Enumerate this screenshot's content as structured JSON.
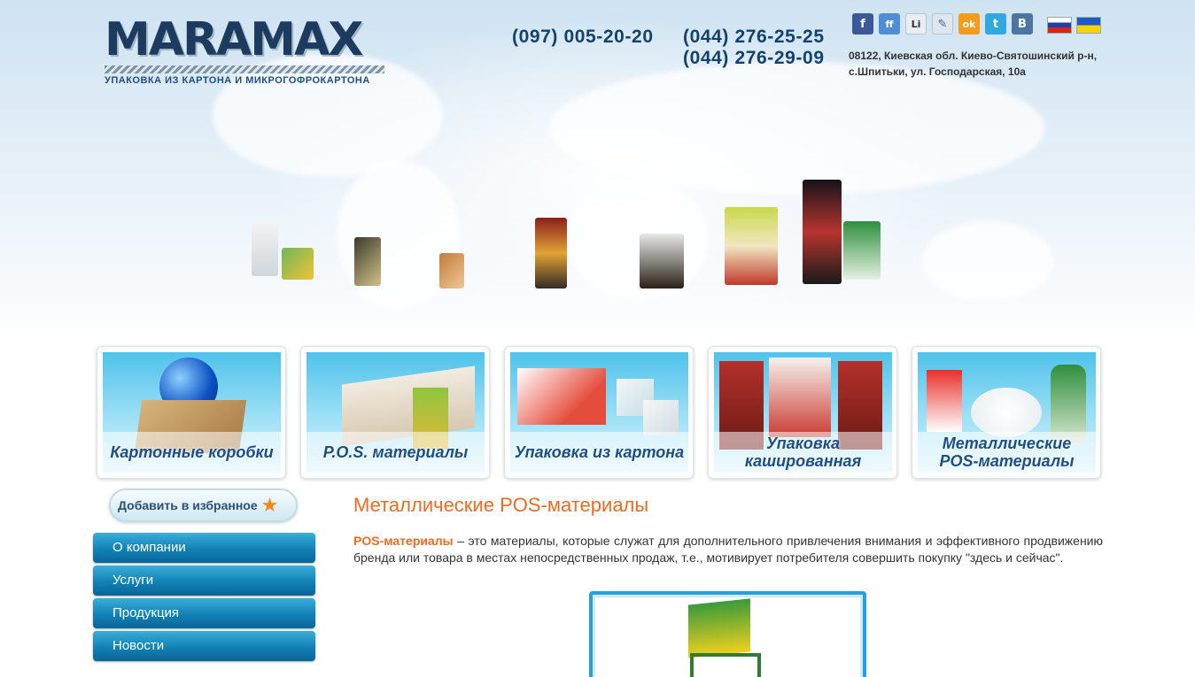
{
  "header": {
    "logo_text": "MARAMAX",
    "logo_subtitle": "УПАКОВКА ИЗ КАРТОНА И МИКРОГОФРОКАРТОНА",
    "phones": [
      "(097) 005-20-20",
      "(044) 276-25-25",
      "(044) 276-29-09"
    ],
    "address_line1": "08122, Киевская обл. Киево-Святошинский р-н,",
    "address_line2": "с.Шпитьки, ул. Господарская, 10а",
    "socials": [
      {
        "name": "facebook",
        "glyph": "f",
        "color": "#3b5998"
      },
      {
        "name": "friendfeed",
        "glyph": "ff",
        "color": "#4f8ed3"
      },
      {
        "name": "linkedin",
        "glyph": "Li",
        "color": "#e9eef2"
      },
      {
        "name": "livejournal",
        "glyph": "✎",
        "color": "#dfe6ee"
      },
      {
        "name": "odnoklassniki",
        "glyph": "ok",
        "color": "#f59a1b"
      },
      {
        "name": "twitter",
        "glyph": "t",
        "color": "#33a8e0"
      },
      {
        "name": "vkontakte",
        "glyph": "B",
        "color": "#4c75a3"
      }
    ],
    "languages": [
      "ru",
      "ua"
    ]
  },
  "categories": [
    {
      "label": "Картонные коробки"
    },
    {
      "label": "P.O.S. материалы"
    },
    {
      "label": "Упаковка из картона"
    },
    {
      "label": "Упаковка кашированная"
    },
    {
      "label": "Металлические POS-материалы"
    }
  ],
  "sidebar": {
    "favorites_label": "Добавить в избранное",
    "nav": [
      "О компании",
      "Услуги",
      "Продукция",
      "Новости"
    ]
  },
  "main": {
    "title": "Металлические POS-материалы",
    "intro_term": "POS-материалы",
    "intro_text": " – это материалы, которые служат для дополнительного привлечения внимания и эффективного продвижению бренда или товара в местах непосредственных продаж, т.е., мотивирует потребителя совершить покупку \"здесь и сейчас\"."
  }
}
